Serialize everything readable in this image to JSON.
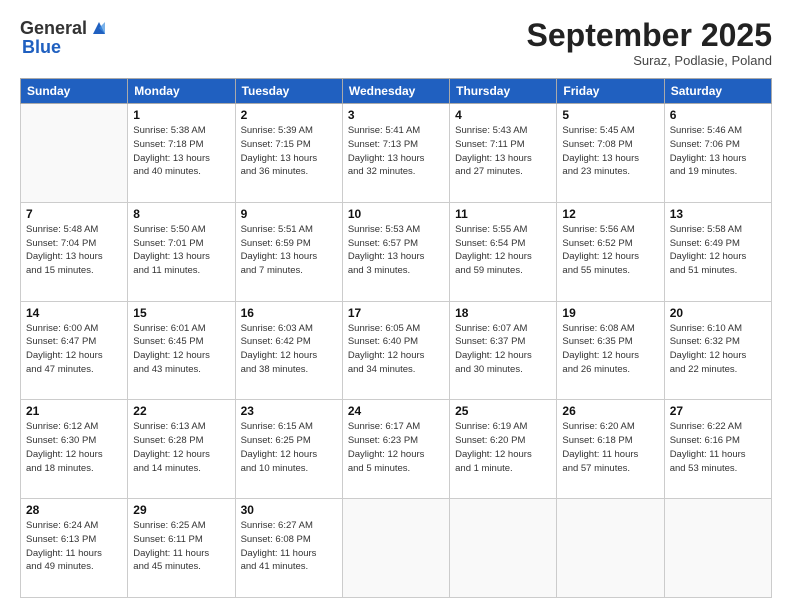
{
  "header": {
    "logo": {
      "general": "General",
      "blue": "Blue"
    },
    "title": "September 2025",
    "subtitle": "Suraz, Podlasie, Poland"
  },
  "days_of_week": [
    "Sunday",
    "Monday",
    "Tuesday",
    "Wednesday",
    "Thursday",
    "Friday",
    "Saturday"
  ],
  "weeks": [
    [
      {
        "day": "",
        "info": ""
      },
      {
        "day": "1",
        "info": "Sunrise: 5:38 AM\nSunset: 7:18 PM\nDaylight: 13 hours\nand 40 minutes."
      },
      {
        "day": "2",
        "info": "Sunrise: 5:39 AM\nSunset: 7:15 PM\nDaylight: 13 hours\nand 36 minutes."
      },
      {
        "day": "3",
        "info": "Sunrise: 5:41 AM\nSunset: 7:13 PM\nDaylight: 13 hours\nand 32 minutes."
      },
      {
        "day": "4",
        "info": "Sunrise: 5:43 AM\nSunset: 7:11 PM\nDaylight: 13 hours\nand 27 minutes."
      },
      {
        "day": "5",
        "info": "Sunrise: 5:45 AM\nSunset: 7:08 PM\nDaylight: 13 hours\nand 23 minutes."
      },
      {
        "day": "6",
        "info": "Sunrise: 5:46 AM\nSunset: 7:06 PM\nDaylight: 13 hours\nand 19 minutes."
      }
    ],
    [
      {
        "day": "7",
        "info": "Sunrise: 5:48 AM\nSunset: 7:04 PM\nDaylight: 13 hours\nand 15 minutes."
      },
      {
        "day": "8",
        "info": "Sunrise: 5:50 AM\nSunset: 7:01 PM\nDaylight: 13 hours\nand 11 minutes."
      },
      {
        "day": "9",
        "info": "Sunrise: 5:51 AM\nSunset: 6:59 PM\nDaylight: 13 hours\nand 7 minutes."
      },
      {
        "day": "10",
        "info": "Sunrise: 5:53 AM\nSunset: 6:57 PM\nDaylight: 13 hours\nand 3 minutes."
      },
      {
        "day": "11",
        "info": "Sunrise: 5:55 AM\nSunset: 6:54 PM\nDaylight: 12 hours\nand 59 minutes."
      },
      {
        "day": "12",
        "info": "Sunrise: 5:56 AM\nSunset: 6:52 PM\nDaylight: 12 hours\nand 55 minutes."
      },
      {
        "day": "13",
        "info": "Sunrise: 5:58 AM\nSunset: 6:49 PM\nDaylight: 12 hours\nand 51 minutes."
      }
    ],
    [
      {
        "day": "14",
        "info": "Sunrise: 6:00 AM\nSunset: 6:47 PM\nDaylight: 12 hours\nand 47 minutes."
      },
      {
        "day": "15",
        "info": "Sunrise: 6:01 AM\nSunset: 6:45 PM\nDaylight: 12 hours\nand 43 minutes."
      },
      {
        "day": "16",
        "info": "Sunrise: 6:03 AM\nSunset: 6:42 PM\nDaylight: 12 hours\nand 38 minutes."
      },
      {
        "day": "17",
        "info": "Sunrise: 6:05 AM\nSunset: 6:40 PM\nDaylight: 12 hours\nand 34 minutes."
      },
      {
        "day": "18",
        "info": "Sunrise: 6:07 AM\nSunset: 6:37 PM\nDaylight: 12 hours\nand 30 minutes."
      },
      {
        "day": "19",
        "info": "Sunrise: 6:08 AM\nSunset: 6:35 PM\nDaylight: 12 hours\nand 26 minutes."
      },
      {
        "day": "20",
        "info": "Sunrise: 6:10 AM\nSunset: 6:32 PM\nDaylight: 12 hours\nand 22 minutes."
      }
    ],
    [
      {
        "day": "21",
        "info": "Sunrise: 6:12 AM\nSunset: 6:30 PM\nDaylight: 12 hours\nand 18 minutes."
      },
      {
        "day": "22",
        "info": "Sunrise: 6:13 AM\nSunset: 6:28 PM\nDaylight: 12 hours\nand 14 minutes."
      },
      {
        "day": "23",
        "info": "Sunrise: 6:15 AM\nSunset: 6:25 PM\nDaylight: 12 hours\nand 10 minutes."
      },
      {
        "day": "24",
        "info": "Sunrise: 6:17 AM\nSunset: 6:23 PM\nDaylight: 12 hours\nand 5 minutes."
      },
      {
        "day": "25",
        "info": "Sunrise: 6:19 AM\nSunset: 6:20 PM\nDaylight: 12 hours\nand 1 minute."
      },
      {
        "day": "26",
        "info": "Sunrise: 6:20 AM\nSunset: 6:18 PM\nDaylight: 11 hours\nand 57 minutes."
      },
      {
        "day": "27",
        "info": "Sunrise: 6:22 AM\nSunset: 6:16 PM\nDaylight: 11 hours\nand 53 minutes."
      }
    ],
    [
      {
        "day": "28",
        "info": "Sunrise: 6:24 AM\nSunset: 6:13 PM\nDaylight: 11 hours\nand 49 minutes."
      },
      {
        "day": "29",
        "info": "Sunrise: 6:25 AM\nSunset: 6:11 PM\nDaylight: 11 hours\nand 45 minutes."
      },
      {
        "day": "30",
        "info": "Sunrise: 6:27 AM\nSunset: 6:08 PM\nDaylight: 11 hours\nand 41 minutes."
      },
      {
        "day": "",
        "info": ""
      },
      {
        "day": "",
        "info": ""
      },
      {
        "day": "",
        "info": ""
      },
      {
        "day": "",
        "info": ""
      }
    ]
  ]
}
